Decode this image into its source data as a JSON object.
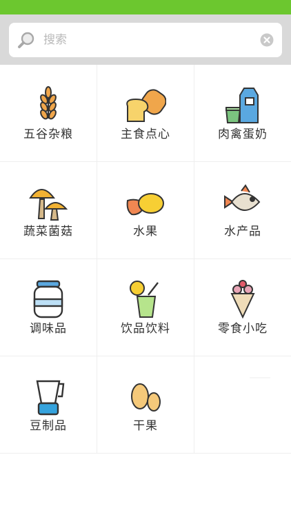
{
  "accent": "#6cc72f",
  "search": {
    "placeholder": "搜索"
  },
  "categories": [
    {
      "label": "五谷杂粮",
      "icon": "wheat-icon"
    },
    {
      "label": "主食点心",
      "icon": "bread-icon"
    },
    {
      "label": "肉禽蛋奶",
      "icon": "milk-carton-icon"
    },
    {
      "label": "蔬菜菌菇",
      "icon": "mushroom-icon"
    },
    {
      "label": "水果",
      "icon": "fruit-icon"
    },
    {
      "label": "水产品",
      "icon": "fish-icon"
    },
    {
      "label": "调味品",
      "icon": "jar-icon"
    },
    {
      "label": "饮品饮料",
      "icon": "drink-icon"
    },
    {
      "label": "零食小吃",
      "icon": "ice-cream-icon"
    },
    {
      "label": "豆制品",
      "icon": "blender-icon"
    },
    {
      "label": "干果",
      "icon": "nuts-icon"
    }
  ]
}
